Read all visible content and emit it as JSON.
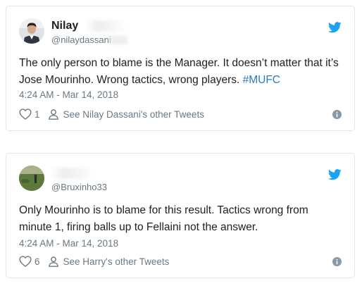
{
  "colors": {
    "text": "#1c2022",
    "secondary": "#697882",
    "link": "#2b7bb9",
    "twitter_blue": "#1da1f2",
    "border": "#e1e8ed"
  },
  "tweets": [
    {
      "display_name": "Nilay",
      "handle": "@nilaydassani",
      "text_plain": "The only person to blame is the Manager. It doesn’t matter that it’s Jose Mourinho. Wrong tactics, wrong players. ",
      "hashtag": "#MUFC",
      "timestamp": "4:24 AM - Mar 14, 2018",
      "like_count": "1",
      "other_tweets_label": "See Nilay Dassani's other Tweets",
      "icons": [
        "avatar",
        "twitter-bird-icon",
        "heart-icon",
        "person-icon",
        "info-icon"
      ]
    },
    {
      "display_name": "",
      "handle": "@Bruxinho33",
      "text_plain": "Only Mourinho is to blame for this result. Tactics wrong from minute 1, firing balls up to Fellaini not the answer.",
      "timestamp": "4:24 AM - Mar 14, 2018",
      "like_count": "6",
      "other_tweets_label": "See Harry's other Tweets",
      "icons": [
        "avatar",
        "twitter-bird-icon",
        "heart-icon",
        "person-icon",
        "info-icon"
      ]
    }
  ]
}
